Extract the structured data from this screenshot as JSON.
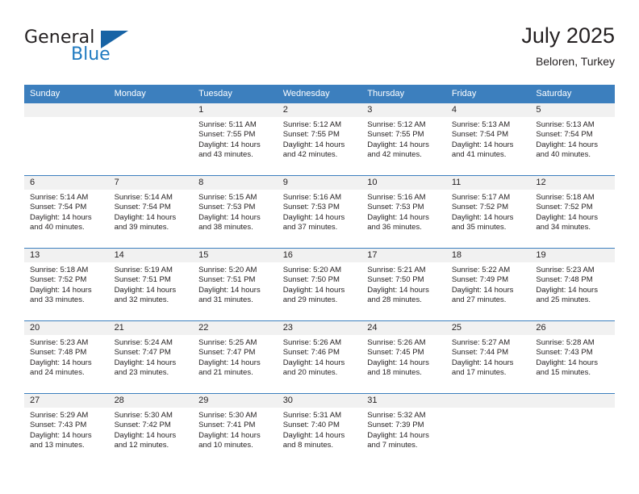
{
  "logo": {
    "word_one": "General",
    "word_two": "Blue",
    "triangle_icon": "blue-triangle-icon",
    "brand_blue": "#1f7ac0",
    "triangle_blue": "#1763a5"
  },
  "header": {
    "title": "July 2025",
    "subtitle": "Beloren, Turkey"
  },
  "theme": {
    "header_bar": "#3c7fbe",
    "daynum_band": "#f1f1f1",
    "text": "#231f20"
  },
  "weekday_headers": [
    "Sunday",
    "Monday",
    "Tuesday",
    "Wednesday",
    "Thursday",
    "Friday",
    "Saturday"
  ],
  "weeks": [
    [
      {
        "day": "",
        "sunrise": "",
        "sunset": "",
        "daylight_line1": "",
        "daylight_line2": ""
      },
      {
        "day": "",
        "sunrise": "",
        "sunset": "",
        "daylight_line1": "",
        "daylight_line2": ""
      },
      {
        "day": "1",
        "sunrise": "Sunrise: 5:11 AM",
        "sunset": "Sunset: 7:55 PM",
        "daylight_line1": "Daylight: 14 hours",
        "daylight_line2": "and 43 minutes."
      },
      {
        "day": "2",
        "sunrise": "Sunrise: 5:12 AM",
        "sunset": "Sunset: 7:55 PM",
        "daylight_line1": "Daylight: 14 hours",
        "daylight_line2": "and 42 minutes."
      },
      {
        "day": "3",
        "sunrise": "Sunrise: 5:12 AM",
        "sunset": "Sunset: 7:55 PM",
        "daylight_line1": "Daylight: 14 hours",
        "daylight_line2": "and 42 minutes."
      },
      {
        "day": "4",
        "sunrise": "Sunrise: 5:13 AM",
        "sunset": "Sunset: 7:54 PM",
        "daylight_line1": "Daylight: 14 hours",
        "daylight_line2": "and 41 minutes."
      },
      {
        "day": "5",
        "sunrise": "Sunrise: 5:13 AM",
        "sunset": "Sunset: 7:54 PM",
        "daylight_line1": "Daylight: 14 hours",
        "daylight_line2": "and 40 minutes."
      }
    ],
    [
      {
        "day": "6",
        "sunrise": "Sunrise: 5:14 AM",
        "sunset": "Sunset: 7:54 PM",
        "daylight_line1": "Daylight: 14 hours",
        "daylight_line2": "and 40 minutes."
      },
      {
        "day": "7",
        "sunrise": "Sunrise: 5:14 AM",
        "sunset": "Sunset: 7:54 PM",
        "daylight_line1": "Daylight: 14 hours",
        "daylight_line2": "and 39 minutes."
      },
      {
        "day": "8",
        "sunrise": "Sunrise: 5:15 AM",
        "sunset": "Sunset: 7:53 PM",
        "daylight_line1": "Daylight: 14 hours",
        "daylight_line2": "and 38 minutes."
      },
      {
        "day": "9",
        "sunrise": "Sunrise: 5:16 AM",
        "sunset": "Sunset: 7:53 PM",
        "daylight_line1": "Daylight: 14 hours",
        "daylight_line2": "and 37 minutes."
      },
      {
        "day": "10",
        "sunrise": "Sunrise: 5:16 AM",
        "sunset": "Sunset: 7:53 PM",
        "daylight_line1": "Daylight: 14 hours",
        "daylight_line2": "and 36 minutes."
      },
      {
        "day": "11",
        "sunrise": "Sunrise: 5:17 AM",
        "sunset": "Sunset: 7:52 PM",
        "daylight_line1": "Daylight: 14 hours",
        "daylight_line2": "and 35 minutes."
      },
      {
        "day": "12",
        "sunrise": "Sunrise: 5:18 AM",
        "sunset": "Sunset: 7:52 PM",
        "daylight_line1": "Daylight: 14 hours",
        "daylight_line2": "and 34 minutes."
      }
    ],
    [
      {
        "day": "13",
        "sunrise": "Sunrise: 5:18 AM",
        "sunset": "Sunset: 7:52 PM",
        "daylight_line1": "Daylight: 14 hours",
        "daylight_line2": "and 33 minutes."
      },
      {
        "day": "14",
        "sunrise": "Sunrise: 5:19 AM",
        "sunset": "Sunset: 7:51 PM",
        "daylight_line1": "Daylight: 14 hours",
        "daylight_line2": "and 32 minutes."
      },
      {
        "day": "15",
        "sunrise": "Sunrise: 5:20 AM",
        "sunset": "Sunset: 7:51 PM",
        "daylight_line1": "Daylight: 14 hours",
        "daylight_line2": "and 31 minutes."
      },
      {
        "day": "16",
        "sunrise": "Sunrise: 5:20 AM",
        "sunset": "Sunset: 7:50 PM",
        "daylight_line1": "Daylight: 14 hours",
        "daylight_line2": "and 29 minutes."
      },
      {
        "day": "17",
        "sunrise": "Sunrise: 5:21 AM",
        "sunset": "Sunset: 7:50 PM",
        "daylight_line1": "Daylight: 14 hours",
        "daylight_line2": "and 28 minutes."
      },
      {
        "day": "18",
        "sunrise": "Sunrise: 5:22 AM",
        "sunset": "Sunset: 7:49 PM",
        "daylight_line1": "Daylight: 14 hours",
        "daylight_line2": "and 27 minutes."
      },
      {
        "day": "19",
        "sunrise": "Sunrise: 5:23 AM",
        "sunset": "Sunset: 7:48 PM",
        "daylight_line1": "Daylight: 14 hours",
        "daylight_line2": "and 25 minutes."
      }
    ],
    [
      {
        "day": "20",
        "sunrise": "Sunrise: 5:23 AM",
        "sunset": "Sunset: 7:48 PM",
        "daylight_line1": "Daylight: 14 hours",
        "daylight_line2": "and 24 minutes."
      },
      {
        "day": "21",
        "sunrise": "Sunrise: 5:24 AM",
        "sunset": "Sunset: 7:47 PM",
        "daylight_line1": "Daylight: 14 hours",
        "daylight_line2": "and 23 minutes."
      },
      {
        "day": "22",
        "sunrise": "Sunrise: 5:25 AM",
        "sunset": "Sunset: 7:47 PM",
        "daylight_line1": "Daylight: 14 hours",
        "daylight_line2": "and 21 minutes."
      },
      {
        "day": "23",
        "sunrise": "Sunrise: 5:26 AM",
        "sunset": "Sunset: 7:46 PM",
        "daylight_line1": "Daylight: 14 hours",
        "daylight_line2": "and 20 minutes."
      },
      {
        "day": "24",
        "sunrise": "Sunrise: 5:26 AM",
        "sunset": "Sunset: 7:45 PM",
        "daylight_line1": "Daylight: 14 hours",
        "daylight_line2": "and 18 minutes."
      },
      {
        "day": "25",
        "sunrise": "Sunrise: 5:27 AM",
        "sunset": "Sunset: 7:44 PM",
        "daylight_line1": "Daylight: 14 hours",
        "daylight_line2": "and 17 minutes."
      },
      {
        "day": "26",
        "sunrise": "Sunrise: 5:28 AM",
        "sunset": "Sunset: 7:43 PM",
        "daylight_line1": "Daylight: 14 hours",
        "daylight_line2": "and 15 minutes."
      }
    ],
    [
      {
        "day": "27",
        "sunrise": "Sunrise: 5:29 AM",
        "sunset": "Sunset: 7:43 PM",
        "daylight_line1": "Daylight: 14 hours",
        "daylight_line2": "and 13 minutes."
      },
      {
        "day": "28",
        "sunrise": "Sunrise: 5:30 AM",
        "sunset": "Sunset: 7:42 PM",
        "daylight_line1": "Daylight: 14 hours",
        "daylight_line2": "and 12 minutes."
      },
      {
        "day": "29",
        "sunrise": "Sunrise: 5:30 AM",
        "sunset": "Sunset: 7:41 PM",
        "daylight_line1": "Daylight: 14 hours",
        "daylight_line2": "and 10 minutes."
      },
      {
        "day": "30",
        "sunrise": "Sunrise: 5:31 AM",
        "sunset": "Sunset: 7:40 PM",
        "daylight_line1": "Daylight: 14 hours",
        "daylight_line2": "and 8 minutes."
      },
      {
        "day": "31",
        "sunrise": "Sunrise: 5:32 AM",
        "sunset": "Sunset: 7:39 PM",
        "daylight_line1": "Daylight: 14 hours",
        "daylight_line2": "and 7 minutes."
      },
      {
        "day": "",
        "sunrise": "",
        "sunset": "",
        "daylight_line1": "",
        "daylight_line2": ""
      },
      {
        "day": "",
        "sunrise": "",
        "sunset": "",
        "daylight_line1": "",
        "daylight_line2": ""
      }
    ]
  ]
}
